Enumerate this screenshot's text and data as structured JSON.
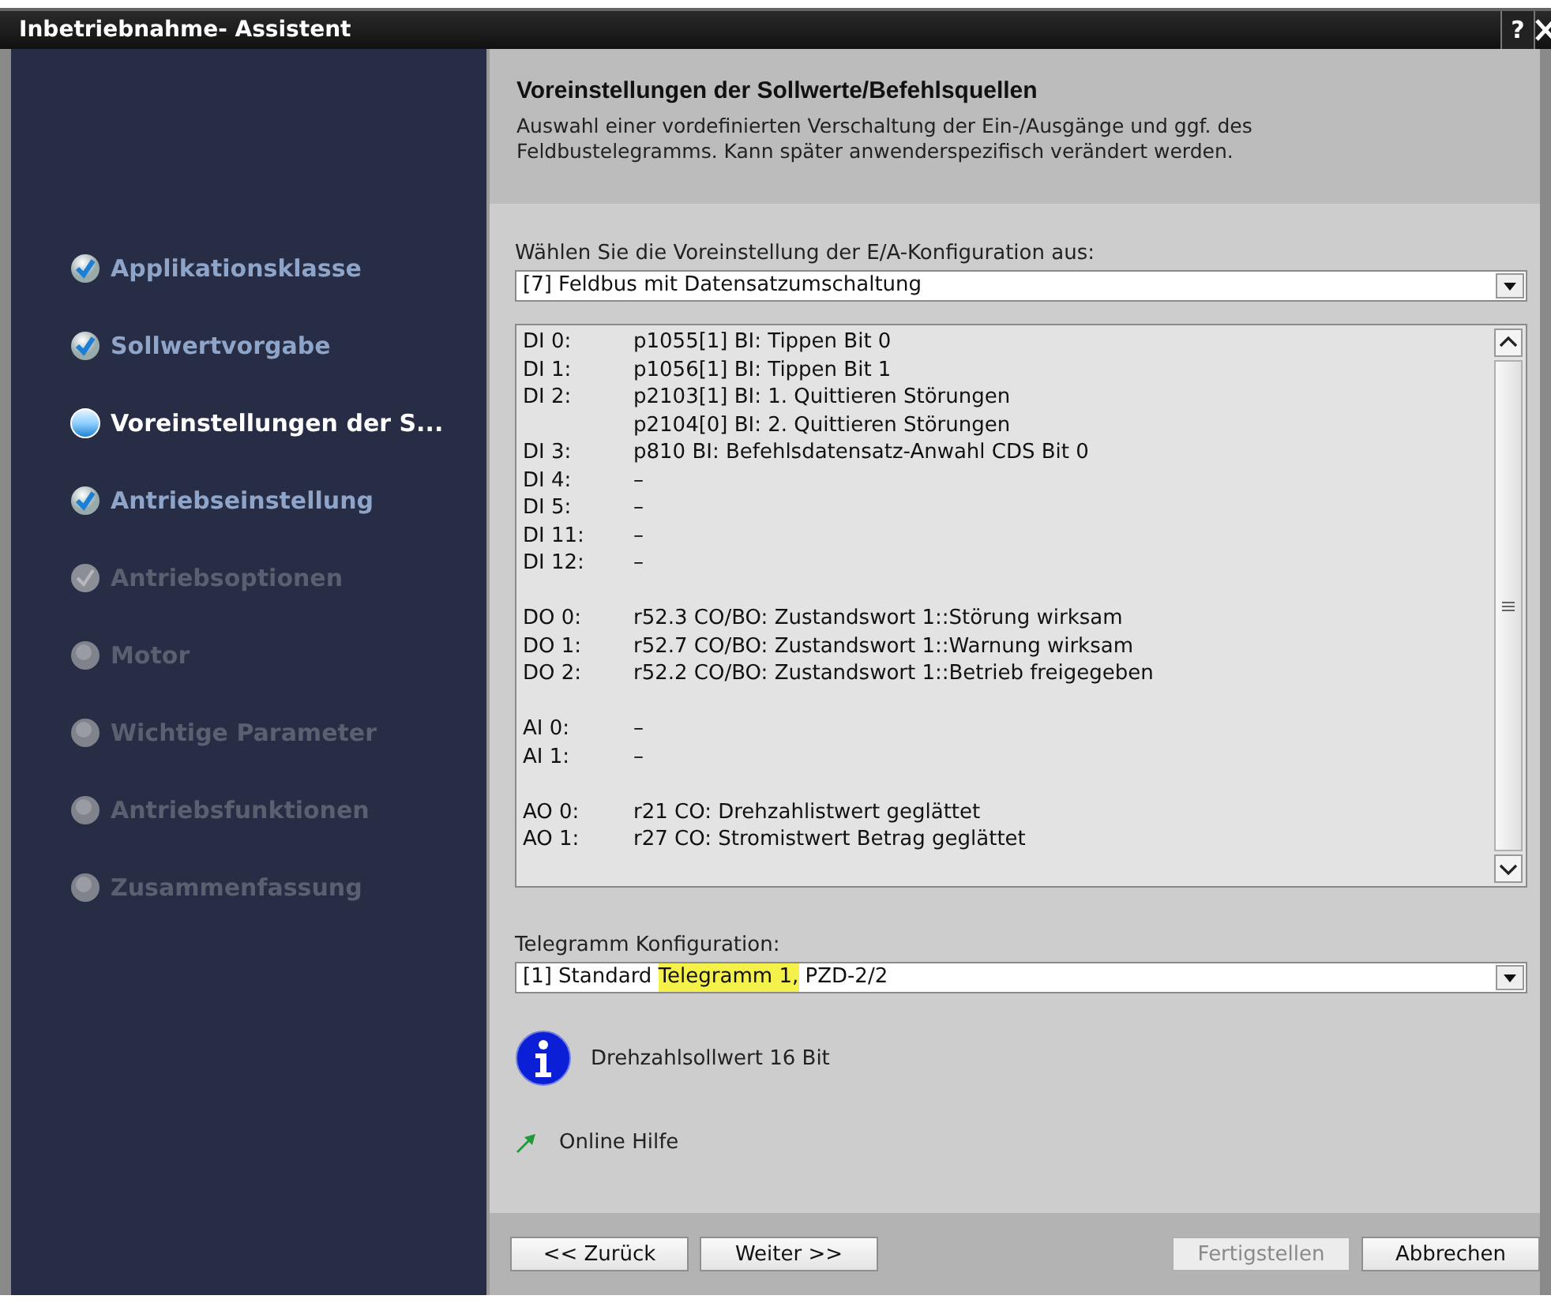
{
  "window": {
    "title": "Inbetriebnahme- Assistent",
    "help": "?"
  },
  "steps": [
    {
      "label": "Applikationsklasse",
      "completed": true,
      "selected": false,
      "disabled": false
    },
    {
      "label": "Sollwertvorgabe",
      "completed": true,
      "selected": false,
      "disabled": false
    },
    {
      "label": "Voreinstellungen der S...",
      "completed": false,
      "selected": true,
      "disabled": false
    },
    {
      "label": "Antriebseinstellung",
      "completed": true,
      "selected": false,
      "disabled": false
    },
    {
      "label": "Antriebsoptionen",
      "completed": true,
      "selected": false,
      "disabled": true
    },
    {
      "label": "Motor",
      "completed": false,
      "selected": false,
      "disabled": true
    },
    {
      "label": "Wichtige Parameter",
      "completed": false,
      "selected": false,
      "disabled": true
    },
    {
      "label": "Antriebsfunktionen",
      "completed": false,
      "selected": false,
      "disabled": true
    },
    {
      "label": "Zusammenfassung",
      "completed": false,
      "selected": false,
      "disabled": true
    }
  ],
  "header": {
    "title": "Voreinstellungen der Sollwerte/Befehlsquellen",
    "description": "Auswahl einer vordefinierten Verschaltung der Ein-/Ausgänge und ggf. des Feldbustelegramms. Kann später anwenderspezifisch verändert werden."
  },
  "io_config": {
    "label": "Wählen Sie die Voreinstellung der E/A-Konfiguration aus:",
    "value": [
      {
        "text": "[7] Feldbus mit Datensatzumschaltung",
        "highlighted": false
      }
    ]
  },
  "assignments": [
    [
      {
        "label": "DI 0:",
        "value": "p1055[1] BI: Tippen Bit 0"
      },
      {
        "label": "DI 1:",
        "value": "p1056[1] BI: Tippen Bit 1"
      },
      {
        "label": "DI 2:",
        "value": "p2103[1] BI: 1. Quittieren Störungen"
      },
      {
        "value": "p2104[0] BI: 2. Quittieren Störungen"
      },
      {
        "label": "DI 3:",
        "value": "p810 BI: Befehlsdatensatz-Anwahl CDS Bit 0"
      },
      {
        "label": "DI 4:",
        "value": "–"
      },
      {
        "label": "DI 5:",
        "value": "–"
      },
      {
        "label": "DI 11:",
        "value": "–"
      },
      {
        "label": "DI 12:",
        "value": "–"
      }
    ],
    [
      {
        "label": "DO 0:",
        "value": "r52.3 CO/BO: Zustandswort 1::Störung wirksam"
      },
      {
        "label": "DO 1:",
        "value": "r52.7 CO/BO: Zustandswort 1::Warnung wirksam"
      },
      {
        "label": "DO 2:",
        "value": "r52.2 CO/BO: Zustandswort 1::Betrieb freigegeben"
      }
    ],
    [
      {
        "label": "AI 0:",
        "value": "–"
      },
      {
        "label": "AI 1:",
        "value": "–"
      }
    ],
    [
      {
        "label": "AO 0:",
        "value": "r21 CO: Drehzahlistwert geglättet"
      },
      {
        "label": "AO 1:",
        "value": "r27 CO: Stromistwert Betrag geglättet"
      }
    ]
  ],
  "telegram_config": {
    "label": "Telegramm Konfiguration:",
    "value": [
      {
        "text": "[1] Standard ",
        "highlighted": false
      },
      {
        "text": "Telegramm 1,",
        "highlighted": true
      },
      {
        "text": " PZD-2/2",
        "highlighted": false
      }
    ]
  },
  "info": {
    "text": "Drehzahlsollwert 16 Bit"
  },
  "help_link": {
    "text": "Online Hilfe"
  },
  "buttons": [
    {
      "label": "<< Zurück",
      "disabled": false
    },
    {
      "label": "Weiter >>",
      "disabled": false
    },
    {
      "label": "Fertigstellen",
      "disabled": true
    },
    {
      "label": "Abbrechen",
      "disabled": false
    }
  ]
}
